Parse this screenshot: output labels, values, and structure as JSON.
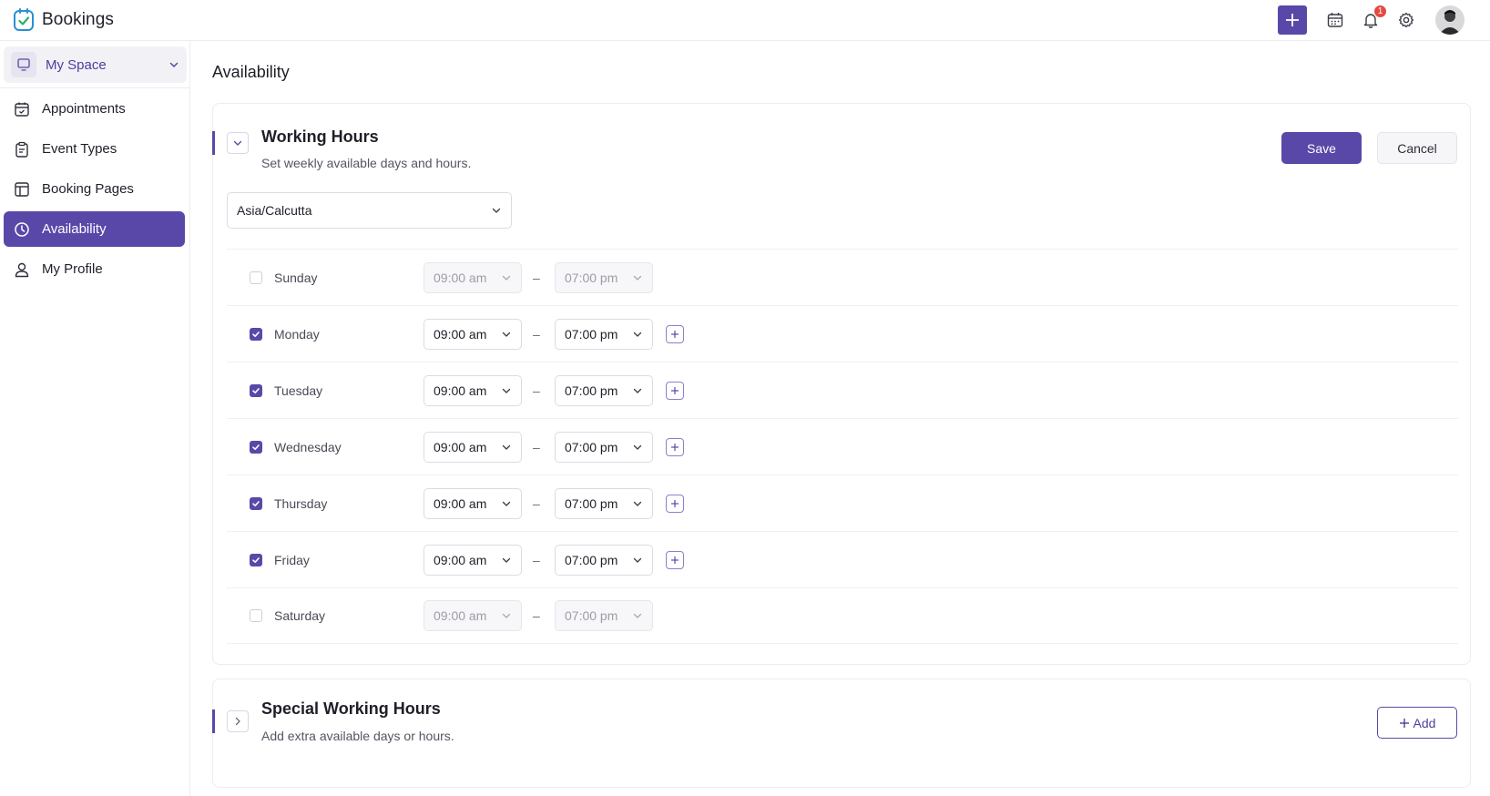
{
  "app": {
    "title": "Bookings"
  },
  "header": {
    "notification_count": "1",
    "colors": {
      "accent": "#5a48a8",
      "badge": "#e5483f"
    }
  },
  "sidebar": {
    "space": "My Space",
    "items": [
      {
        "label": "Appointments",
        "icon": "calendar-check-icon",
        "active": false
      },
      {
        "label": "Event Types",
        "icon": "clipboard-icon",
        "active": false
      },
      {
        "label": "Booking Pages",
        "icon": "layout-icon",
        "active": false
      },
      {
        "label": "Availability",
        "icon": "clock-icon",
        "active": true
      },
      {
        "label": "My Profile",
        "icon": "user-icon",
        "active": false
      }
    ]
  },
  "main": {
    "page_title": "Availability",
    "working_hours": {
      "title": "Working Hours",
      "subtitle": "Set weekly available days and hours.",
      "save_label": "Save",
      "cancel_label": "Cancel",
      "timezone": "Asia/Calcutta",
      "separator": "–",
      "days": [
        {
          "name": "Sunday",
          "enabled": false,
          "start": "09:00 am",
          "end": "07:00 pm"
        },
        {
          "name": "Monday",
          "enabled": true,
          "start": "09:00 am",
          "end": "07:00 pm"
        },
        {
          "name": "Tuesday",
          "enabled": true,
          "start": "09:00 am",
          "end": "07:00 pm"
        },
        {
          "name": "Wednesday",
          "enabled": true,
          "start": "09:00 am",
          "end": "07:00 pm"
        },
        {
          "name": "Thursday",
          "enabled": true,
          "start": "09:00 am",
          "end": "07:00 pm"
        },
        {
          "name": "Friday",
          "enabled": true,
          "start": "09:00 am",
          "end": "07:00 pm"
        },
        {
          "name": "Saturday",
          "enabled": false,
          "start": "09:00 am",
          "end": "07:00 pm"
        }
      ]
    },
    "special_hours": {
      "title": "Special Working Hours",
      "subtitle": "Add extra available days or hours.",
      "add_label": "Add"
    }
  }
}
